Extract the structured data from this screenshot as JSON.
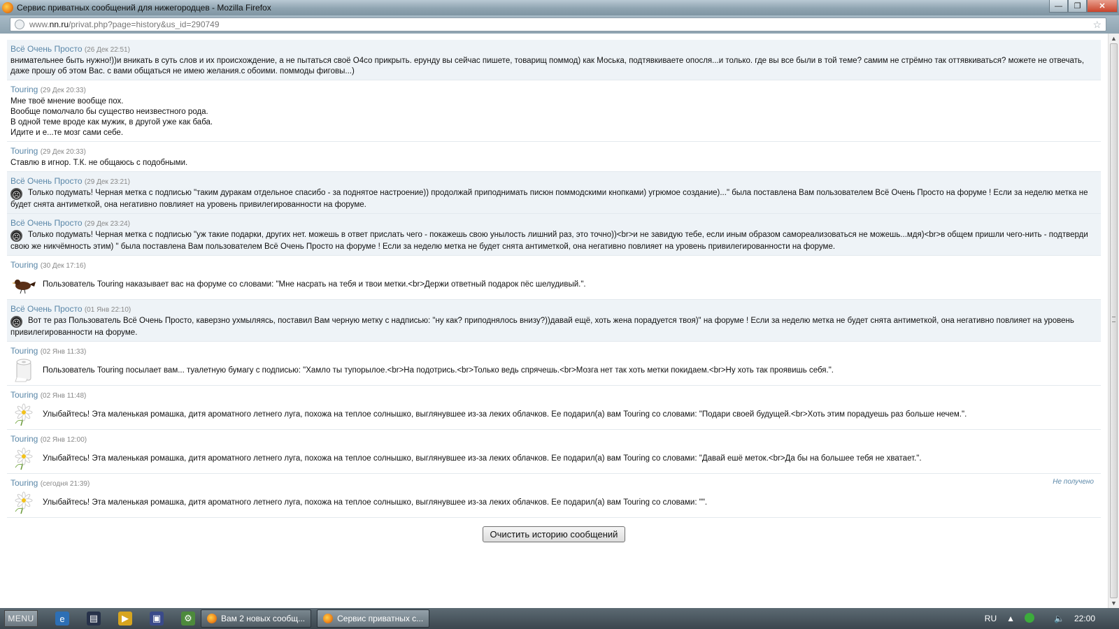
{
  "window": {
    "title": "Сервис приватных сообщений для нижегородцев - Mozilla Firefox",
    "minimize": "—",
    "maximize": "❐",
    "close": "✕"
  },
  "address": {
    "url_prefix": "www.",
    "url_domain": "nn.ru",
    "url_path": "/privat.php?page=history&us_id=290749"
  },
  "messages": [
    {
      "author": "Всё Очень Просто",
      "date": "(26 Дек 22:51)",
      "type": "text",
      "alt": true,
      "lines": [
        "внимательнее быть нужно!))и вникать в суть слов и их происхождение, а не пытаться своё О4со прикрыть. ерунду вы сейчас пишете, товарищ поммод) как Моська, подтявкиваете опосля...и только. где вы все были в той теме? самим не стрёмно так оттявкиваться? можете не отвечать, даже прошу об этом Вас. с вами общаться не имею желания.с обоими. поммоды фиговы...)"
      ]
    },
    {
      "author": "Touring",
      "date": "(29 Дек 20:33)",
      "type": "text",
      "alt": false,
      "lines": [
        "Мне твоё мнение вообще пох.",
        "Вообще помолчало бы существо неизвестного рода.",
        "В одной теме вроде как мужик, в другой уже как баба.",
        "Идите и е...те мозг сами себе."
      ]
    },
    {
      "author": "Touring",
      "date": "(29 Дек 20:33)",
      "type": "text",
      "alt": false,
      "lines": [
        "Ставлю в игнор. Т.К. не общаюсь с подобными."
      ]
    },
    {
      "author": "Всё Очень Просто",
      "date": "(29 Дек 23:21)",
      "type": "mark",
      "alt": true,
      "text": "Только подумать! Черная метка с подписью \"таким дуракам отдельное спасибо - за поднятое настроение)) продолжай приподнимать писюн поммодскими кнопками) угрюмое создание)...\" была поставлена Вам пользователем Всё Очень Просто на форуме ! Если за неделю метка не будет снята антиметкой, она негативно повлияет на уровень привилегированности на форуме."
    },
    {
      "author": "Всё Очень Просто",
      "date": "(29 Дек 23:24)",
      "type": "mark",
      "alt": true,
      "text": "Только подумать! Черная метка с подписью \"уж такие подарки, других нет. можешь в ответ прислать чего - покажешь свою унылость лишний раз, это точно))<br>и не завидую тебе, если иным образом самореализоваться не можешь...мдя)<br>в общем пришли чего-нить - подтверди свою же никчёмность этим) \" была поставлена Вам пользователем Всё Очень Просто на форуме ! Если за неделю метка не будет снята антиметкой, она негативно повлияет на уровень привилегированности на форуме."
    },
    {
      "author": "Touring",
      "date": "(30 Дек 17:16)",
      "type": "gift",
      "gift": "bird",
      "alt": false,
      "text": "Пользователь Touring наказывает вас на форуме со словами: \"Мне насрать на тебя и твои метки.<br>Держи ответный подарок пёс шелудивый.\"."
    },
    {
      "author": "Всё Очень Просто",
      "date": "(01 Янв 22:10)",
      "type": "mark",
      "alt": true,
      "text": "Вот те раз Пользователь Всё Очень Просто, каверзно ухмыляясь, поставил Вам черную метку с надписью: \"ну как? приподнялось внизу?))давай ещё, хоть жена порадуется твоя)\" на форуме ! Если за неделю метка не будет снята антиметкой, она негативно повлияет на уровень привилегированности на форуме."
    },
    {
      "author": "Touring",
      "date": "(02 Янв 11:33)",
      "type": "gift",
      "gift": "paper",
      "alt": false,
      "text": "Пользователь Touring посылает вам... туалетную бумагу с подписью: \"Хамло ты тупорылое.<br>На подотрись.<br>Только ведь спрячешь.<br>Мозга нет так хоть метки покидаем.<br>Ну хоть так проявишь себя.\"."
    },
    {
      "author": "Touring",
      "date": "(02 Янв 11:48)",
      "type": "gift",
      "gift": "daisy",
      "alt": false,
      "text": "Улыбайтесь! Эта маленькая ромашка, дитя ароматного летнего луга, похожа на теплое солнышко, выглянувшее из-за леких облачков. Ее подарил(а) вам Touring со словами: \"Подари своей будущей.<br>Хоть этим порадуешь раз больше нечем.\"."
    },
    {
      "author": "Touring",
      "date": "(02 Янв 12:00)",
      "type": "gift",
      "gift": "daisy",
      "alt": false,
      "text": "Улыбайтесь! Эта маленькая ромашка, дитя ароматного летнего луга, похожа на теплое солнышко, выглянувшее из-за леких облачков. Ее подарил(а) вам Touring со словами: \"Давай ешё меток.<br>Да бы на большее тебя не хватает.\"."
    },
    {
      "author": "Touring",
      "date": "(сегодня 21:39)",
      "type": "gift",
      "gift": "daisy",
      "alt": false,
      "status": "Не получено",
      "text": "Улыбайтесь! Эта маленькая ромашка, дитя ароматного летнего луга, похожа на теплое солнышко, выглянувшее из-за леких облачков. Ее подарил(а) вам Touring со словами: \"\"."
    }
  ],
  "clear_button": "Очистить историю сообщений",
  "taskbar": {
    "menu": "MENU",
    "tasks": [
      "Вам 2 новых сообщ...",
      "Сервис приватных с..."
    ],
    "lang": "RU",
    "time": "22:00"
  },
  "icons": {
    "mark": "black-mark-icon",
    "bird": "bird-gift-icon",
    "paper": "toilet-paper-icon",
    "daisy": "daisy-icon"
  }
}
